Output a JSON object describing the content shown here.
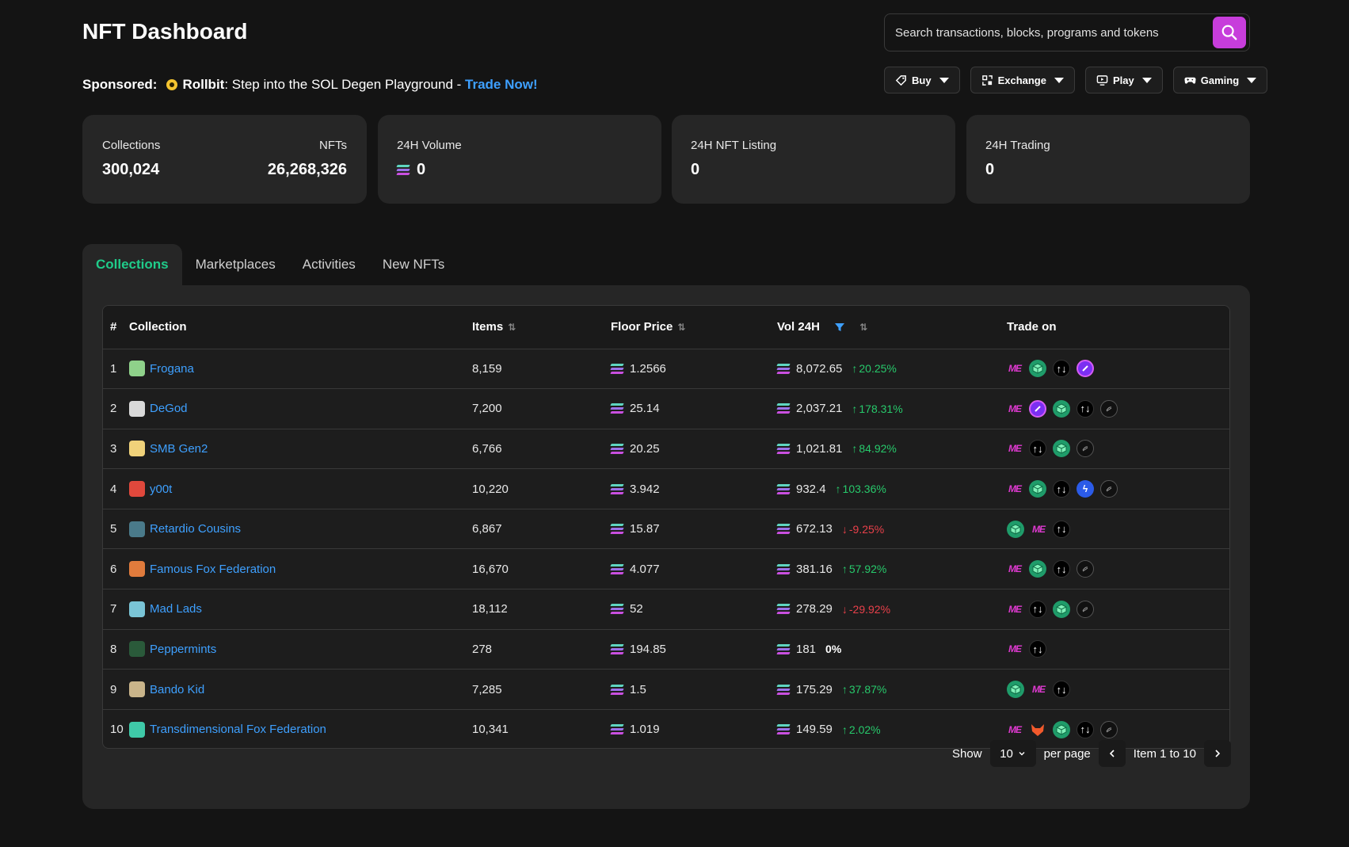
{
  "header": {
    "title": "NFT Dashboard"
  },
  "search": {
    "placeholder": "Search transactions, blocks, programs and tokens"
  },
  "sponsored": {
    "label": "Sponsored:",
    "brand": "Rollbit",
    "text": ": Step into the SOL Degen Playground - ",
    "cta": "Trade Now!"
  },
  "menus": [
    {
      "label": "Buy",
      "icon": "tag-icon"
    },
    {
      "label": "Exchange",
      "icon": "exchange-icon"
    },
    {
      "label": "Play",
      "icon": "play-icon"
    },
    {
      "label": "Gaming",
      "icon": "gamepad-icon"
    }
  ],
  "stats": {
    "collections_label": "Collections",
    "collections_value": "300,024",
    "nfts_label": "NFTs",
    "nfts_value": "26,268,326",
    "volume_label": "24H Volume",
    "volume_value": "0",
    "listing_label": "24H NFT Listing",
    "listing_value": "0",
    "trading_label": "24H Trading",
    "trading_value": "0"
  },
  "tabs": [
    "Collections",
    "Marketplaces",
    "Activities",
    "New NFTs"
  ],
  "table": {
    "headers": {
      "idx": "#",
      "collection": "Collection",
      "items": "Items",
      "floor": "Floor Price",
      "vol": "Vol 24H",
      "trade": "Trade on"
    },
    "rows": [
      {
        "idx": "1",
        "name": "Frogana",
        "items": "8,159",
        "floor": "1.2566",
        "vol": "8,072.65",
        "change": "20.25%",
        "dir": "up",
        "avatar": "#8fd18a",
        "markets": [
          "me",
          "cube",
          "tensor",
          "hadeswap"
        ]
      },
      {
        "idx": "2",
        "name": "DeGod",
        "items": "7,200",
        "floor": "25.14",
        "vol": "2,037.21",
        "change": "178.31%",
        "dir": "up",
        "avatar": "#d9d9d9",
        "markets": [
          "me",
          "hadeswap",
          "cube",
          "tensor",
          "solanart"
        ]
      },
      {
        "idx": "3",
        "name": "SMB Gen2",
        "items": "6,766",
        "floor": "20.25",
        "vol": "1,021.81",
        "change": "84.92%",
        "dir": "up",
        "avatar": "#f0d27a",
        "markets": [
          "me",
          "tensor",
          "cube",
          "solanart"
        ]
      },
      {
        "idx": "4",
        "name": "y00t",
        "items": "10,220",
        "floor": "3.942",
        "vol": "932.4",
        "change": "103.36%",
        "dir": "up",
        "avatar": "#e0483c",
        "markets": [
          "me",
          "cube",
          "tensor",
          "hyperspace",
          "solanart"
        ]
      },
      {
        "idx": "5",
        "name": "Retardio Cousins",
        "items": "6,867",
        "floor": "15.87",
        "vol": "672.13",
        "change": "-9.25%",
        "dir": "down",
        "avatar": "#4a7a8a",
        "markets": [
          "cube",
          "me",
          "tensor"
        ]
      },
      {
        "idx": "6",
        "name": "Famous Fox Federation",
        "items": "16,670",
        "floor": "4.077",
        "vol": "381.16",
        "change": "57.92%",
        "dir": "up",
        "avatar": "#e07b3c",
        "markets": [
          "me",
          "cube",
          "tensor",
          "solanart"
        ]
      },
      {
        "idx": "7",
        "name": "Mad Lads",
        "items": "18,112",
        "floor": "52",
        "vol": "278.29",
        "change": "-29.92%",
        "dir": "down",
        "avatar": "#7ac4d6",
        "markets": [
          "me",
          "tensor",
          "cube",
          "solanart"
        ]
      },
      {
        "idx": "8",
        "name": "Peppermints",
        "items": "278",
        "floor": "194.85",
        "vol": "181",
        "change": "0%",
        "dir": "zero",
        "avatar": "#2a5a3a",
        "markets": [
          "me",
          "tensor"
        ]
      },
      {
        "idx": "9",
        "name": "Bando Kid",
        "items": "7,285",
        "floor": "1.5",
        "vol": "175.29",
        "change": "37.87%",
        "dir": "up",
        "avatar": "#c9b48a",
        "markets": [
          "cube",
          "me",
          "tensor"
        ]
      },
      {
        "idx": "10",
        "name": "Transdimensional Fox Federation",
        "items": "10,341",
        "floor": "1.019",
        "vol": "149.59",
        "change": "2.02%",
        "dir": "up",
        "avatar": "#3fc9a8",
        "markets": [
          "me",
          "fox",
          "cube",
          "tensor",
          "solanart"
        ]
      }
    ]
  },
  "pager": {
    "show_label": "Show",
    "per_page_value": "10",
    "per_page_label": "per page",
    "range": "Item 1 to 10"
  },
  "colors": {
    "accent": "#c73ddb",
    "link": "#3ea0ff",
    "active_tab": "#1fcc8a",
    "up": "#27c96b",
    "down": "#e8404a"
  }
}
